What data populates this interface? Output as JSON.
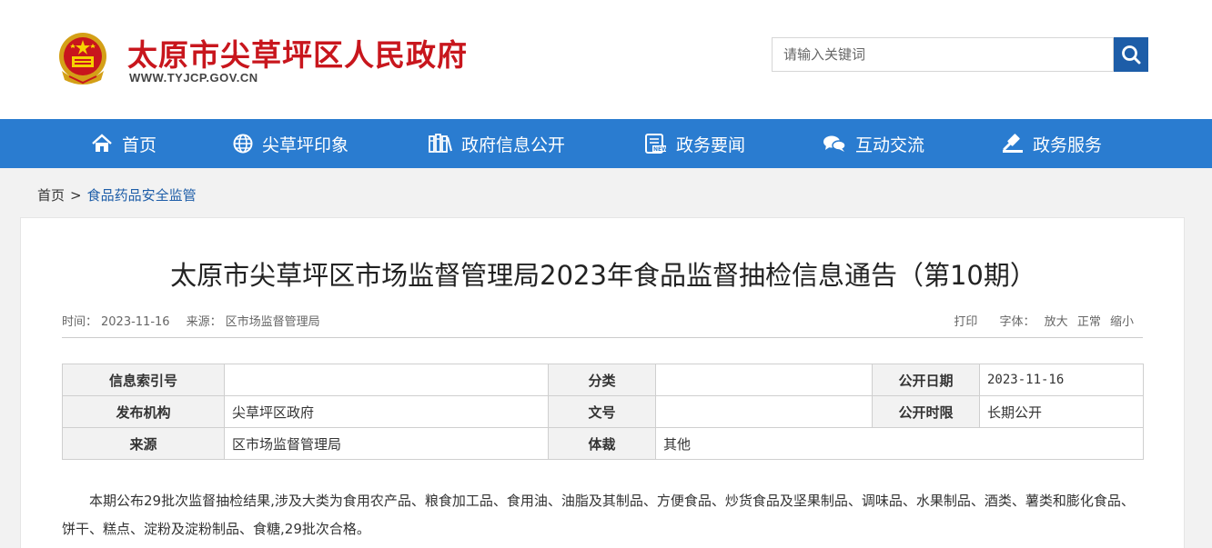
{
  "header": {
    "site_name": "太原市尖草坪区人民政府",
    "site_url": "WWW.TYJCP.GOV.CN",
    "search_placeholder": "请输入关键词",
    "colors": {
      "brand_red": "#c8161d",
      "nav_blue": "#2a7cd0",
      "search_blue": "#1d5da8"
    }
  },
  "nav": {
    "items": [
      {
        "label": "首页",
        "icon": "home-icon"
      },
      {
        "label": "尖草坪印象",
        "icon": "globe-icon"
      },
      {
        "label": "政府信息公开",
        "icon": "books-icon"
      },
      {
        "label": "政务要闻",
        "icon": "news-icon"
      },
      {
        "label": "互动交流",
        "icon": "chat-icon"
      },
      {
        "label": "政务服务",
        "icon": "gavel-icon"
      }
    ]
  },
  "breadcrumb": {
    "home": "首页",
    "separator": ">",
    "current": "食品药品安全监管"
  },
  "article": {
    "title": "太原市尖草坪区市场监督管理局2023年食品监督抽检信息通告（第10期）",
    "time_label": "时间：",
    "time_value": "2023-11-16",
    "source_label": "来源：",
    "source_value": "区市场监督管理局",
    "print_label": "打印",
    "font_label": "字体：",
    "font_large": "放大",
    "font_normal": "正常",
    "font_small": "缩小"
  },
  "info_table": {
    "index_label": "信息索引号",
    "index_value": "",
    "category_label": "分类",
    "category_value": "",
    "publish_date_label": "公开日期",
    "publish_date_value": "2023-11-16",
    "org_label": "发布机构",
    "org_value": "尖草坪区政府",
    "doc_no_label": "文号",
    "doc_no_value": "",
    "period_label": "公开时限",
    "period_value": "长期公开",
    "source_label": "来源",
    "source_value": "区市场监督管理局",
    "genre_label": "体裁",
    "genre_value": "其他"
  },
  "body": {
    "paragraph": "本期公布29批次监督抽检结果,涉及大类为食用农产品、粮食加工品、食用油、油脂及其制品、方便食品、炒货食品及坚果制品、调味品、水果制品、酒类、薯类和膨化食品、饼干、糕点、淀粉及淀粉制品、食糖,29批次合格。"
  }
}
